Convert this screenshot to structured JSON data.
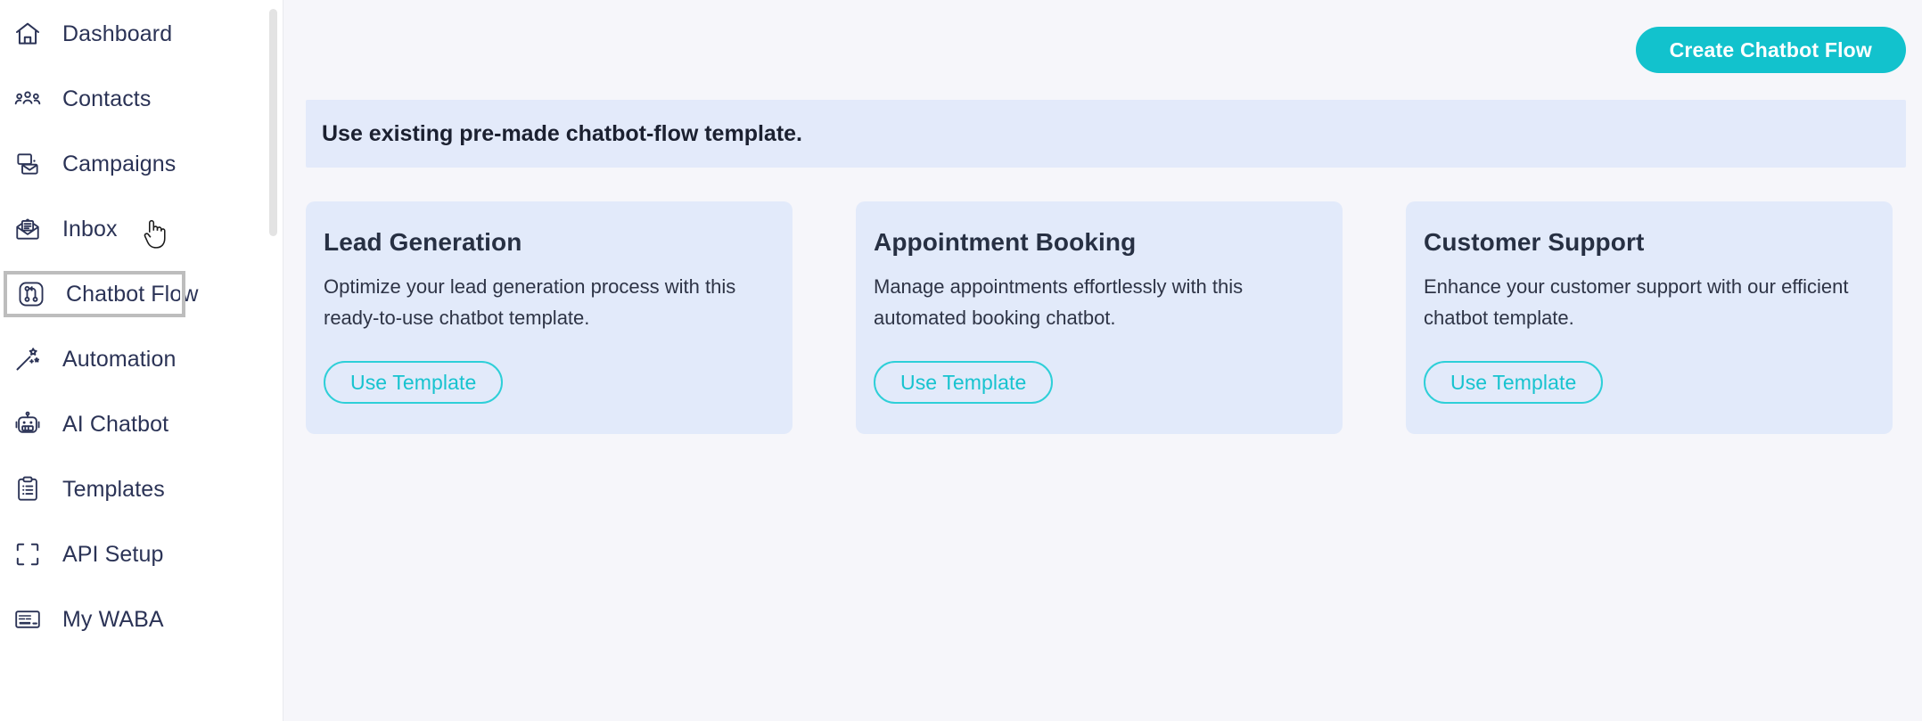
{
  "colors": {
    "accent": "#12c2cd",
    "accent_outline": "#2ecfd8",
    "sidebar_text": "#2b3356",
    "banner_bg": "#e3eafa",
    "card_bg": "#e2eafa",
    "main_bg": "#f6f6fa"
  },
  "sidebar": {
    "items": [
      {
        "label": "Dashboard",
        "icon": "home-icon",
        "active": false
      },
      {
        "label": "Contacts",
        "icon": "contacts-icon",
        "active": false
      },
      {
        "label": "Campaigns",
        "icon": "campaigns-icon",
        "active": false
      },
      {
        "label": "Inbox",
        "icon": "inbox-icon",
        "active": false
      },
      {
        "label": "Chatbot Flow",
        "icon": "chatbot-flow-icon",
        "active": true
      },
      {
        "label": "Automation",
        "icon": "magic-wand-icon",
        "active": false
      },
      {
        "label": "AI Chatbot",
        "icon": "robot-icon",
        "active": false
      },
      {
        "label": "Templates",
        "icon": "clipboard-icon",
        "active": false
      },
      {
        "label": "API Setup",
        "icon": "brackets-icon",
        "active": false
      },
      {
        "label": "My WABA",
        "icon": "card-icon",
        "active": false
      }
    ]
  },
  "topbar": {
    "create_button_label": "Create Chatbot Flow"
  },
  "banner": {
    "text": "Use existing pre-made chatbot-flow template."
  },
  "cards": [
    {
      "title": "Lead Generation",
      "description": "Optimize your lead generation process with this ready-to-use chatbot template.",
      "button_label": "Use Template"
    },
    {
      "title": "Appointment Booking",
      "description": "Manage appointments effortlessly with this automated booking chatbot.",
      "button_label": "Use Template"
    },
    {
      "title": "Customer Support",
      "description": "Enhance your customer support with our efficient chatbot template.",
      "button_label": "Use Template"
    }
  ]
}
